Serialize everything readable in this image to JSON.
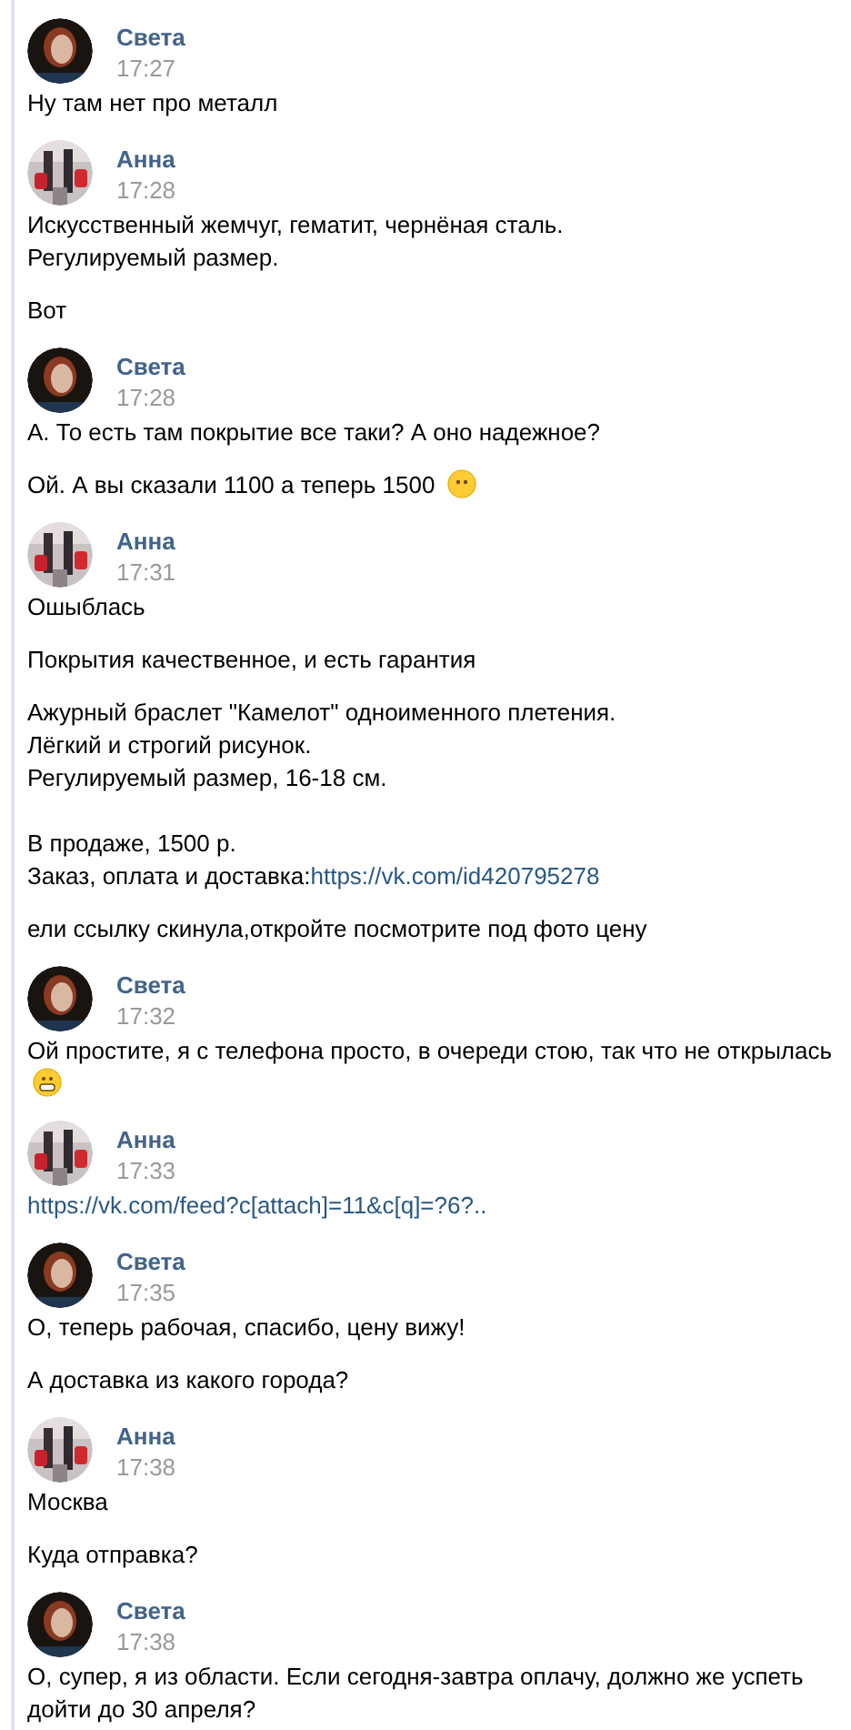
{
  "groups": [
    {
      "author": "Света",
      "time": "17:27",
      "avatar": {
        "kind": "sveta"
      },
      "messages": [
        {
          "text": "Ну там нет про металл"
        }
      ]
    },
    {
      "author": "Анна",
      "time": "17:28",
      "avatar": {
        "kind": "anna"
      },
      "messages": [
        {
          "text": "Искусственный жемчуг, гематит, чернёная сталь.\nРегулируемый размер."
        },
        {
          "text": "Вот"
        }
      ]
    },
    {
      "author": "Света",
      "time": "17:28",
      "avatar": {
        "kind": "sveta"
      },
      "messages": [
        {
          "text": "А. То есть там покрытие все таки? А оно надежное?"
        },
        {
          "text": "Ой. А вы сказали 1100 а теперь 1500",
          "emoji": {
            "kind": "neutral"
          }
        }
      ]
    },
    {
      "author": "Анна",
      "time": "17:31",
      "avatar": {
        "kind": "anna"
      },
      "messages": [
        {
          "text": "Ошыблась"
        },
        {
          "text": "Покрытия качественное, и есть гарантия"
        },
        {
          "text": "Ажурный браслет \"Камелот\" одноименного плетения.\nЛёгкий и строгий рисунок.\nРегулируемый размер, 16-18 см.\n\nВ продаже, 1500 р.\nЗаказ, оплата и доставка:",
          "link": "https://vk.com/id420795278"
        },
        {
          "text": "ели ссылку скинула,откройте посмотрите под фото цену"
        }
      ]
    },
    {
      "author": "Света",
      "time": "17:32",
      "avatar": {
        "kind": "sveta"
      },
      "messages": [
        {
          "text": "Ой простите, я с телефона просто, в очереди стою, так что не открылась",
          "emoji": {
            "kind": "grin"
          }
        }
      ]
    },
    {
      "author": "Анна",
      "time": "17:33",
      "avatar": {
        "kind": "anna"
      },
      "messages": [
        {
          "link": "https://vk.com/feed?c[attach]=11&c[q]=?6?.."
        }
      ]
    },
    {
      "author": "Света",
      "time": "17:35",
      "avatar": {
        "kind": "sveta"
      },
      "messages": [
        {
          "text": "О, теперь рабочая, спасибо, цену вижу!"
        },
        {
          "text": "А доставка из какого города?"
        }
      ]
    },
    {
      "author": "Анна",
      "time": "17:38",
      "avatar": {
        "kind": "anna"
      },
      "messages": [
        {
          "text": "Москва"
        },
        {
          "text": "Куда отправка?"
        }
      ]
    },
    {
      "author": "Света",
      "time": "17:38",
      "avatar": {
        "kind": "sveta"
      },
      "messages": [
        {
          "text": "О, супер, я из области. Если сегодня-завтра оплачу, должно же успеть дойти до 30 апреля?"
        }
      ]
    }
  ]
}
